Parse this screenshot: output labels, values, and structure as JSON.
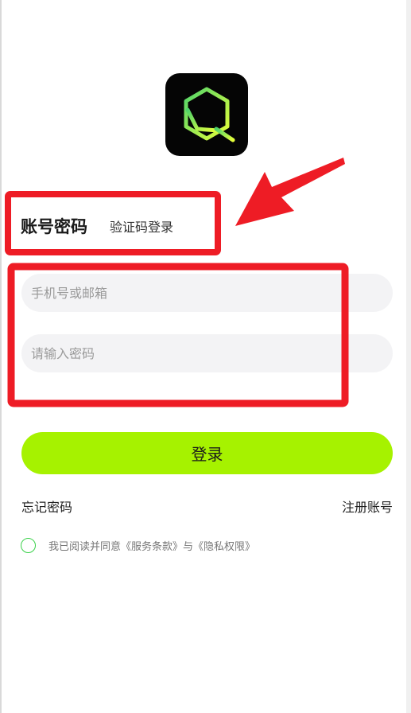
{
  "app": {
    "logo_icon": "hexagon-q-logo-icon",
    "accent_color": "#a6f200",
    "logo_gradient": [
      "#4fd46a",
      "#e6ff3a"
    ]
  },
  "tabs": {
    "account_password": "账号密码",
    "verification_code": "验证码登录"
  },
  "form": {
    "phone_placeholder": "手机号或邮箱",
    "password_placeholder": "请输入密码",
    "phone_value": "",
    "password_value": ""
  },
  "actions": {
    "login_label": "登录",
    "forgot_password": "忘记密码",
    "register": "注册账号"
  },
  "agreement": {
    "text": "我已阅读并同意《服务条款》与《隐私权限》",
    "checked": false
  },
  "annotations": {
    "highlight_color": "#ee1c25",
    "arrow_icon": "red-arrow-icon"
  }
}
